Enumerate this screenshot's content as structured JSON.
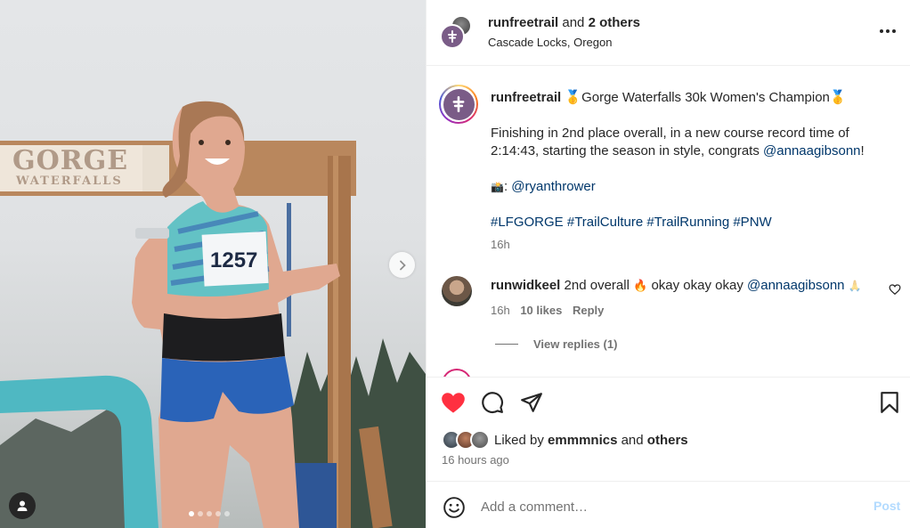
{
  "header": {
    "username": "runfreetrail",
    "and_text": "and",
    "others": "2 others",
    "location": "Cascade Locks, Oregon"
  },
  "photo": {
    "sign_line1": "GORGE",
    "sign_line2": "WATERFALLS",
    "bib": "1257",
    "carousel_count": 5,
    "carousel_active": 0
  },
  "caption": {
    "username": "runfreetrail",
    "medal": "🥇",
    "title": "Gorge Waterfalls 30k Women's Champion",
    "body_part1": "Finishing in 2nd place overall, in a new course record time of",
    "body_part2": "2:14:43, starting the season in style, congrats",
    "mention": "@annaagibsonn",
    "body_end": "!",
    "camera_emoji": "📸",
    "photo_credit_sep": ":",
    "photo_credit": "@ryanthrower",
    "hashtags": [
      "#LFGORGE",
      "#TrailCulture",
      "#TrailRunning",
      "#PNW"
    ],
    "time": "16h"
  },
  "comment": {
    "username": "runwidkeel",
    "text_part1": "2nd overall",
    "fire_emoji": "🔥",
    "text_part2": "okay okay okay",
    "mention": "@annaagibsonn",
    "trailing_emoji": "🙏",
    "time": "16h",
    "likes": "10 likes",
    "reply_label": "Reply",
    "view_replies": "View replies (1)"
  },
  "likes": {
    "prefix": "Liked by",
    "user": "emmmnics",
    "and_text": "and",
    "others": "others",
    "timestamp": "16 hours ago"
  },
  "add_comment": {
    "placeholder": "Add a comment…",
    "post_label": "Post"
  },
  "colors": {
    "heart_red": "#ff3040",
    "link_blue": "#00376b",
    "post_disabled": "#b3dbff",
    "brand_purple": "#7a5c87"
  },
  "icons": {
    "more": "more-horizontal-icon",
    "like": "heart-filled-icon",
    "comment": "comment-bubble-icon",
    "share": "share-plane-icon",
    "save": "bookmark-icon",
    "emoji": "emoji-smile-icon",
    "next": "chevron-right-icon",
    "tags": "user-tag-icon"
  }
}
